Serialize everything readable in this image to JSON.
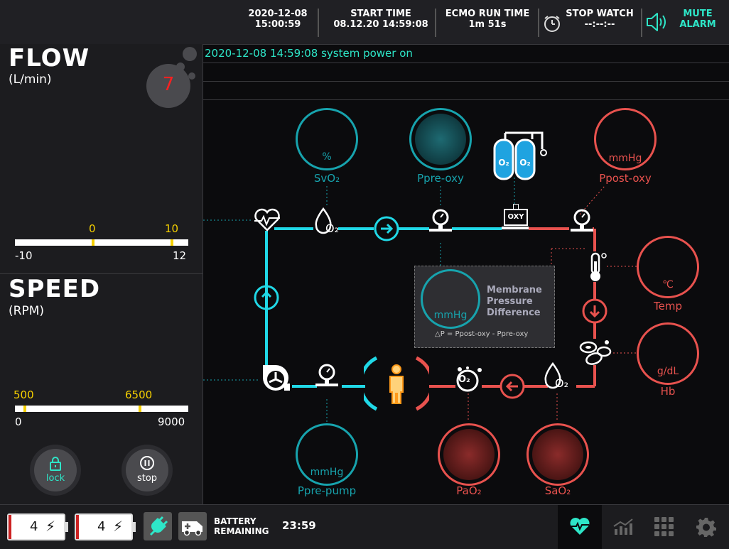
{
  "topbar": {
    "datetime_date": "2020-12-08",
    "datetime_time": "15:00:59",
    "start_label": "START TIME",
    "start_value": "08.12.20 14:59:08",
    "ecmo_label": "ECMO RUN TIME",
    "ecmo_value": "1m 51s",
    "stopwatch_label": "STOP WATCH",
    "stopwatch_value": "--:--:--",
    "mute_line1": "MUTE",
    "mute_line2": "ALARM"
  },
  "flow": {
    "title": "FLOW",
    "unit": "(L/min)",
    "badge": "7",
    "bar_min": "-10",
    "bar_max": "12",
    "low_mark": "0",
    "high_mark": "10"
  },
  "speed": {
    "title": "SPEED",
    "unit": "(RPM)",
    "bar_min": "0",
    "bar_max": "9000",
    "low_mark": "500",
    "high_mark": "6500"
  },
  "controls": {
    "lock_label": "lock",
    "stop_label": "stop"
  },
  "log": {
    "entries": [
      "2020-12-08 14:59:08  system power on",
      "",
      ""
    ]
  },
  "diagram": {
    "svo2": {
      "unit": "%",
      "label": "SvO₂"
    },
    "ppre_oxy": {
      "label": "Ppre-oxy"
    },
    "ppost_oxy": {
      "unit": "mmHg",
      "label": "Ppost-oxy"
    },
    "oxy_label": "OXY",
    "o2_tank": "O₂",
    "membrane": {
      "unit": "mmHg",
      "line1": "Membrane",
      "line2": "Pressure",
      "line3": "Difference",
      "formula": "△P = Ppost-oxy - Ppre-oxy"
    },
    "temp": {
      "unit": "℃",
      "label": "Temp"
    },
    "hb": {
      "unit": "g/dL",
      "label": "Hb"
    },
    "ppre_pump": {
      "unit": "mmHg",
      "label": "Ppre-pump"
    },
    "pao2": {
      "label": "PaO₂"
    },
    "sao2": {
      "label": "SaO₂"
    },
    "o2_symbol": "O₂"
  },
  "bottombar": {
    "battery1": "4",
    "battery2": "4",
    "battery_label_1": "BATTERY",
    "battery_label_2": "REMAINING",
    "battery_time": "23:59"
  },
  "colors": {
    "teal": "#17a3ad",
    "cyan": "#20d8e6",
    "red": "#e8524e",
    "yellow": "#f5d000",
    "mint": "#2ee6c8"
  }
}
